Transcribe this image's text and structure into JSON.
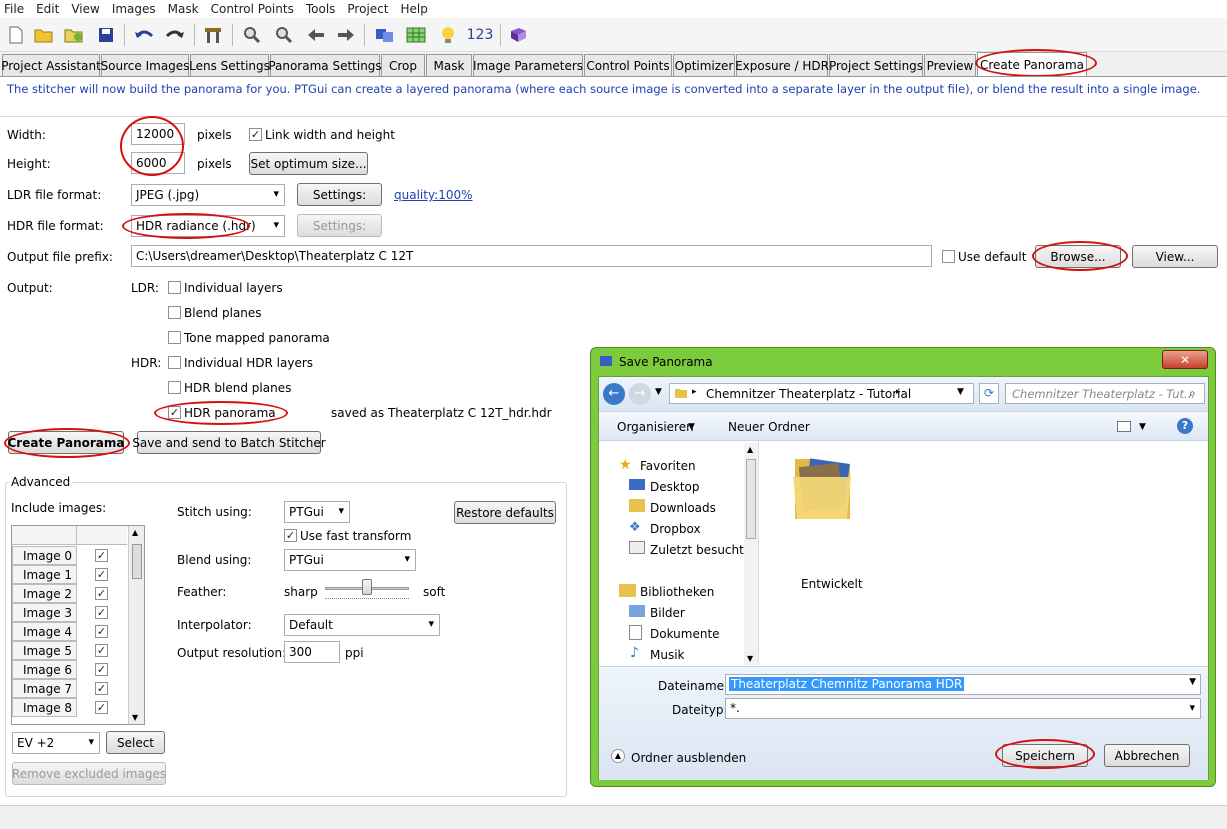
{
  "menu": [
    "File",
    "Edit",
    "View",
    "Images",
    "Mask",
    "Control Points",
    "Tools",
    "Project",
    "Help"
  ],
  "toolbar": {
    "icons": [
      "new-file-icon",
      "open-folder-icon",
      "open-recent-icon",
      "save-icon",
      "undo-icon",
      "redo-icon",
      "align-tools-icon",
      "zoom-in-icon",
      "zoom-out-icon",
      "arrow-left-icon",
      "arrow-right-icon",
      "panorama-editor-icon",
      "table-icon",
      "lightbulb-icon",
      "numbers-icon",
      "book-icon"
    ],
    "numbers_label": "123"
  },
  "tabs": [
    "Project Assistant",
    "Source Images",
    "Lens Settings",
    "Panorama Settings",
    "Crop",
    "Mask",
    "Image Parameters",
    "Control Points",
    "Optimizer",
    "Exposure / HDR",
    "Project Settings",
    "Preview",
    "Create Panorama"
  ],
  "info_text": "The stitcher will now build the panorama for you. PTGui can create a layered panorama (where each source image is converted into a separate layer in the output file), or blend the result into a single image.",
  "form": {
    "width_label": "Width:",
    "width_value": "12000",
    "height_label": "Height:",
    "height_value": "6000",
    "pixels": "pixels",
    "link_label": "Link width and height",
    "optimum_btn": "Set optimum size...",
    "ldr_label": "LDR file format:",
    "ldr_value": "JPEG (.jpg)",
    "settings_btn": "Settings:",
    "quality_link": "quality:100%",
    "hdr_label": "HDR file format:",
    "hdr_value": "HDR radiance (.hdr)",
    "hdr_settings_btn": "Settings:",
    "prefix_label": "Output file prefix:",
    "prefix_value": "C:\\Users\\dreamer\\Desktop\\Theaterplatz C 12T",
    "use_default": "Use default",
    "browse_btn": "Browse...",
    "view_btn": "View...",
    "output_label": "Output:",
    "ldr_short": "LDR:",
    "hdr_short": "HDR:",
    "individual_layers": "Individual layers",
    "blend_planes": "Blend planes",
    "tone_mapped": "Tone mapped panorama",
    "individual_hdr": "Individual HDR layers",
    "hdr_blend": "HDR blend planes",
    "hdr_panorama": "HDR panorama",
    "saved_as": "saved as Theaterplatz C 12T_hdr.hdr",
    "create_btn": "Create Panorama",
    "batch_btn": "Save and send to Batch Stitcher"
  },
  "advanced": {
    "title": "Advanced",
    "include_label": "Include images:",
    "images": [
      "Image 0",
      "Image 1",
      "Image 2",
      "Image 3",
      "Image 4",
      "Image 5",
      "Image 6",
      "Image 7",
      "Image 8"
    ],
    "ev_value": "EV +2",
    "select_btn": "Select",
    "remove_btn": "Remove excluded images",
    "stitch_label": "Stitch using:",
    "stitch_value": "PTGui",
    "fast_transform": "Use fast transform",
    "restore_btn": "Restore defaults",
    "blend_label": "Blend using:",
    "blend_value": "PTGui",
    "feather_label": "Feather:",
    "sharp": "sharp",
    "soft": "soft",
    "feather_level": 0.5,
    "interp_label": "Interpolator:",
    "interp_value": "Default",
    "res_label": "Output resolution:",
    "res_value": "300",
    "ppi": "ppi"
  },
  "dialog": {
    "title": "Save Panorama",
    "close": "✕",
    "path_folder": "Chemnitzer Theaterplatz - Tutorial",
    "search_placeholder": "Chemnitzer Theaterplatz - Tut...",
    "organize": "Organisieren",
    "new_folder": "Neuer Ordner",
    "favorites_title": "Favoriten",
    "favorites": [
      "Desktop",
      "Downloads",
      "Dropbox",
      "Zuletzt besucht"
    ],
    "libraries_title": "Bibliotheken",
    "libraries": [
      "Bilder",
      "Dokumente",
      "Musik"
    ],
    "folder_name": "Entwickelt",
    "filename_label": "Dateiname:",
    "filename_value": "Theaterplatz Chemnitz Panorama HDR",
    "filetype_label": "Dateityp:",
    "filetype_value": "*.",
    "hide_folders": "Ordner ausblenden",
    "save_btn": "Speichern",
    "cancel_btn": "Abbrechen"
  },
  "colors": {
    "annotation_red": "#d51010",
    "dialog_frame": "#7ccb3c",
    "info_blue": "#1f3fb3"
  }
}
